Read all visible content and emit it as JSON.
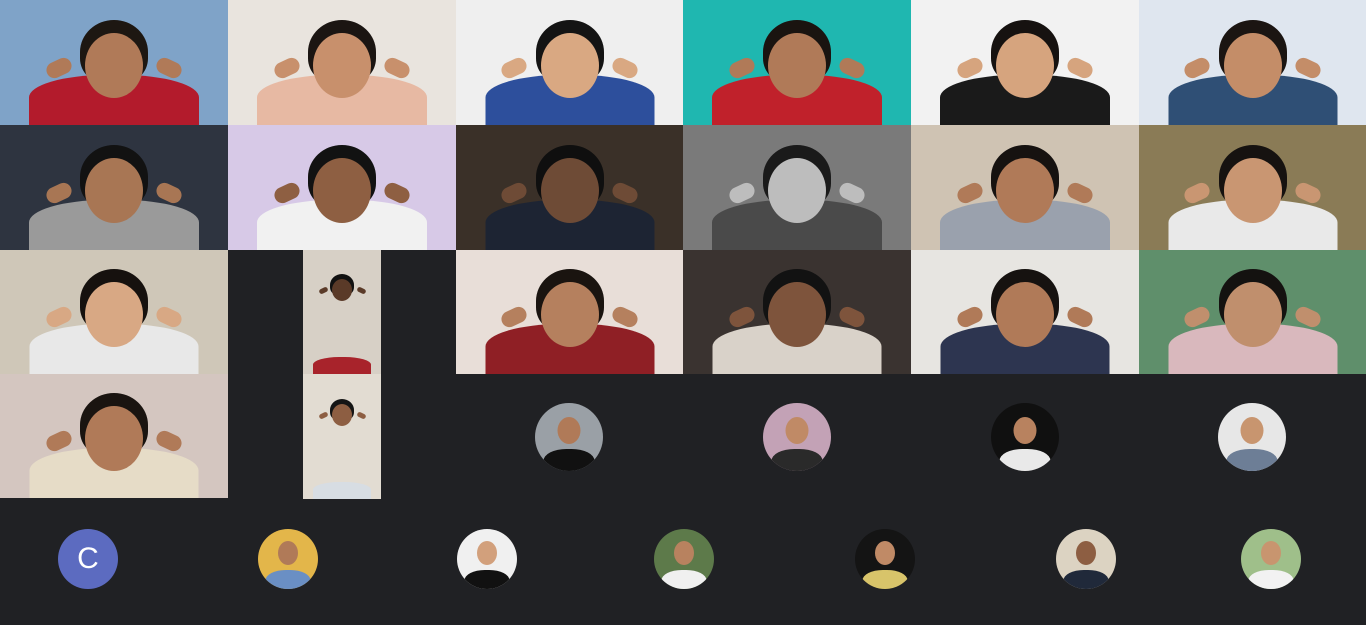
{
  "meeting": {
    "participant_tiles": [
      {
        "id": "p1",
        "wall": "#7fa3c8",
        "skin": "#b07a58",
        "hair": "#1d1712",
        "shirt": "#b31b2c",
        "speaking": true
      },
      {
        "id": "p2",
        "wall": "#e9e4de",
        "skin": "#c8906c",
        "hair": "#1b1512",
        "shirt": "#e7b9a3",
        "speaking": false
      },
      {
        "id": "p3",
        "wall": "#efefef",
        "skin": "#d9a882",
        "hair": "#141414",
        "shirt": "#2d4f9c",
        "speaking": false
      },
      {
        "id": "p4",
        "wall": "#1fb7b0",
        "skin": "#b07a58",
        "hair": "#1a1410",
        "shirt": "#c0212b",
        "speaking": false
      },
      {
        "id": "p5",
        "wall": "#f2f2f2",
        "skin": "#d6a47e",
        "hair": "#161210",
        "shirt": "#1a1a1a",
        "speaking": false
      },
      {
        "id": "p6",
        "wall": "#dfe6ef",
        "skin": "#c48d68",
        "hair": "#1b1512",
        "shirt": "#2f4f75",
        "speaking": false
      },
      {
        "id": "p7",
        "wall": "#2e3440",
        "skin": "#a87654",
        "hair": "#121212",
        "shirt": "#9a9a9a",
        "speaking": false
      },
      {
        "id": "p8",
        "wall": "#d7c9e7",
        "skin": "#8e5f42",
        "hair": "#121212",
        "shirt": "#f1f1f1",
        "speaking": false
      },
      {
        "id": "p9",
        "wall": "#3a3028",
        "skin": "#6e4b36",
        "hair": "#0f0f0f",
        "shirt": "#1d2433",
        "speaking": false
      },
      {
        "id": "p10",
        "wall": "#7a7a7a",
        "skin": "#bdbdbd",
        "hair": "#1a1a1a",
        "shirt": "#4a4a4a",
        "speaking": false
      },
      {
        "id": "p11",
        "wall": "#cfc3b3",
        "skin": "#b07a58",
        "hair": "#161210",
        "shirt": "#9aa1ad",
        "speaking": false
      },
      {
        "id": "p12",
        "wall": "#8a7b56",
        "skin": "#c99672",
        "hair": "#161210",
        "shirt": "#e9e9e9",
        "speaking": false
      },
      {
        "id": "p13",
        "wall": "#cfc7b8",
        "skin": "#d8a884",
        "hair": "#16110e",
        "shirt": "#e8e8e8",
        "speaking": false
      },
      {
        "id": "p14",
        "wall": "#d7d0c6",
        "skin": "#5a3a28",
        "hair": "#111111",
        "shirt": "#a8232b",
        "speaking": false
      },
      {
        "id": "p15",
        "wall": "#e8ded8",
        "skin": "#b5805e",
        "hair": "#1a1410",
        "shirt": "#8f1f25",
        "speaking": false
      },
      {
        "id": "p16",
        "wall": "#3a3330",
        "skin": "#7e543c",
        "hair": "#121212",
        "shirt": "#d9d2c9",
        "speaking": false
      },
      {
        "id": "p17",
        "wall": "#e7e5e1",
        "skin": "#b07a58",
        "hair": "#161210",
        "shirt": "#2d3550",
        "speaking": false
      },
      {
        "id": "p18",
        "wall": "#5f8f6b",
        "skin": "#c08f6d",
        "hair": "#141210",
        "shirt": "#d9b8bd",
        "speaking": false
      },
      {
        "id": "p19",
        "wall": "#d4c6c0",
        "skin": "#b07a58",
        "hair": "#1a1410",
        "shirt": "#e6dcc7",
        "speaking": false
      },
      {
        "id": "p20",
        "wall": "#e2dcd2",
        "skin": "#8d5e42",
        "hair": "#151515",
        "shirt": "#d7dde3",
        "speaking": false
      }
    ],
    "avatars_row1": [
      {
        "id": "a1",
        "bg": "#9aa0a6",
        "skin": "#b07a58",
        "shirt": "#111111"
      },
      {
        "id": "a2",
        "bg": "#c3a2b6",
        "skin": "#c08a66",
        "shirt": "#2a2a2a"
      },
      {
        "id": "a3",
        "bg": "#101010",
        "skin": "#b8825f",
        "shirt": "#e9e9e9"
      },
      {
        "id": "a4",
        "bg": "#e7e7e7",
        "skin": "#c8956f",
        "shirt": "#6d7e96"
      }
    ],
    "avatars_row2": [
      {
        "id": "c",
        "letter": "C",
        "bg": "#5c6bc0"
      },
      {
        "id": "b1",
        "bg": "#e3b64a",
        "skin": "#b07a58",
        "shirt": "#6a8fc4"
      },
      {
        "id": "b2",
        "bg": "#f0f0f0",
        "skin": "#d2a07c",
        "shirt": "#111111"
      },
      {
        "id": "b3",
        "bg": "#5d7a4a",
        "skin": "#b8825f",
        "shirt": "#f0f0f0"
      },
      {
        "id": "b4",
        "bg": "#141414",
        "skin": "#c08a66",
        "shirt": "#d8c46a"
      },
      {
        "id": "b5",
        "bg": "#dcd3c2",
        "skin": "#8d5e42",
        "shirt": "#20293a"
      },
      {
        "id": "b6",
        "bg": "#9fbf8a",
        "skin": "#c8956f",
        "shirt": "#f2f2f2"
      }
    ],
    "colors": {
      "background": "#202124",
      "speaking_indicator": "#46e0d0"
    }
  }
}
